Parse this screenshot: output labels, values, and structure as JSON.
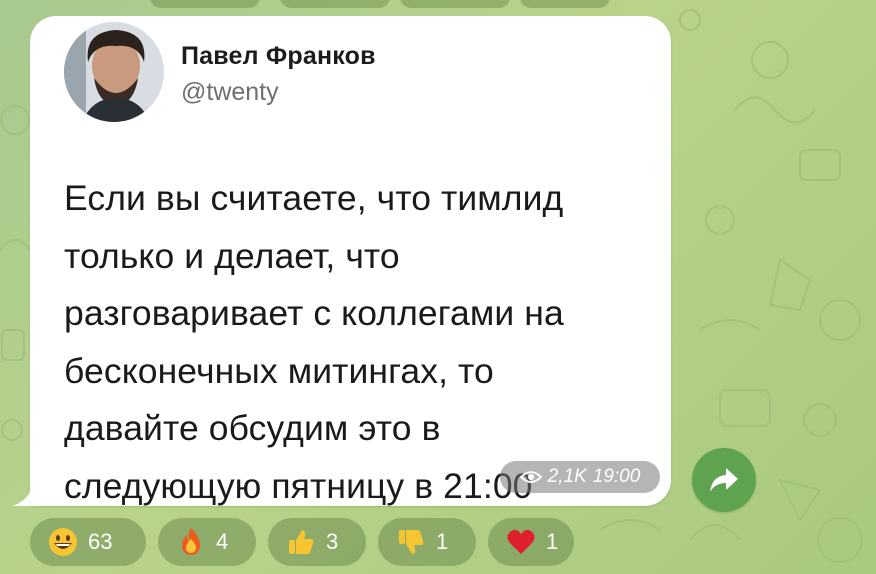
{
  "post": {
    "author_name": "Павел Франков",
    "author_handle": "@twenty",
    "text": "Если вы считаете, что тимлид\nтолько и делает, что\nразговаривает с коллегами на\nбесконечных митингах, то\nдавайте обсудим это в\nследующую пятницу в 21:00",
    "views": "2,1K",
    "time": "19:00"
  },
  "reactions": [
    {
      "emoji": "grinning-face-icon",
      "count": "63"
    },
    {
      "emoji": "fire-icon",
      "count": "4"
    },
    {
      "emoji": "thumbs-up-icon",
      "count": "3"
    },
    {
      "emoji": "thumbs-down-icon",
      "count": "1"
    },
    {
      "emoji": "red-heart-icon",
      "count": "1"
    }
  ],
  "colors": {
    "background": "#b2cf88",
    "bubble": "#ffffff",
    "share_button": "#5fa24f",
    "reaction_pill": "#7a9a5a"
  }
}
